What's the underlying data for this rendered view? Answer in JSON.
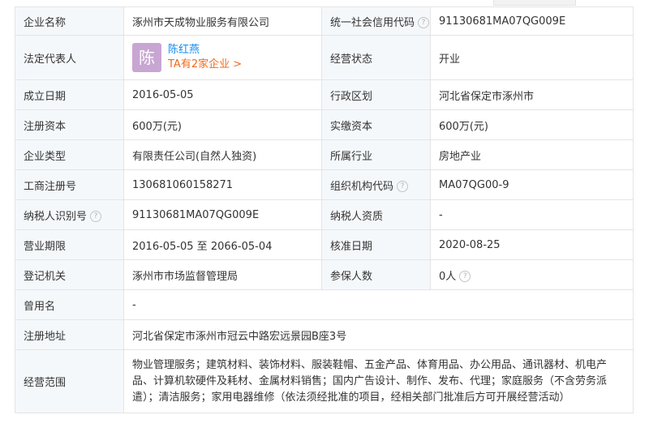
{
  "rows": {
    "r1": {
      "k1": "企业名称",
      "v1": "涿州市天成物业服务有限公司",
      "k2": "统一社会信用代码",
      "v2": "91130681MA07QG009E"
    },
    "r2": {
      "k1": "法定代表人",
      "avatar_char": "陈",
      "person_name": "陈红燕",
      "person_link": "TA有2家企业 >",
      "k2": "经营状态",
      "v2": "开业"
    },
    "r3": {
      "k1": "成立日期",
      "v1": "2016-05-05",
      "k2": "行政区划",
      "v2": "河北省保定市涿州市"
    },
    "r4": {
      "k1": "注册资本",
      "v1": "600万(元)",
      "k2": "实缴资本",
      "v2": "600万(元)"
    },
    "r5": {
      "k1": "企业类型",
      "v1": "有限责任公司(自然人独资)",
      "k2": "所属行业",
      "v2": "房地产业"
    },
    "r6": {
      "k1": "工商注册号",
      "v1": "130681060158271",
      "k2": "组织机构代码",
      "v2": "MA07QG00-9"
    },
    "r7": {
      "k1": "纳税人识别号",
      "v1": "91130681MA07QG009E",
      "k2": "纳税人资质",
      "v2": "-"
    },
    "r8": {
      "k1": "营业期限",
      "v1": "2016-05-05 至 2066-05-04",
      "k2": "核准日期",
      "v2": "2020-08-25"
    },
    "r9": {
      "k1": "登记机关",
      "v1": "涿州市市场监督管理局",
      "k2": "参保人数",
      "v2": "0人"
    },
    "r10": {
      "k1": "曾用名",
      "v1": "-"
    },
    "r11": {
      "k1": "注册地址",
      "v1": "河北省保定市涿州市冠云中路宏远景园B座3号"
    },
    "r12": {
      "k1": "经营范围",
      "v1": "物业管理服务；建筑材料、装饰材料、服装鞋帽、五金产品、体育用品、办公用品、通讯器材、机电产品、计算机软硬件及耗材、金属材料销售；国内广告设计、制作、发布、代理；家庭服务（不含劳务派遣）；清洁服务；家用电器维修（依法须经批准的项目，经相关部门批准后方可开展经营活动）"
    }
  },
  "help_glyph": "?"
}
